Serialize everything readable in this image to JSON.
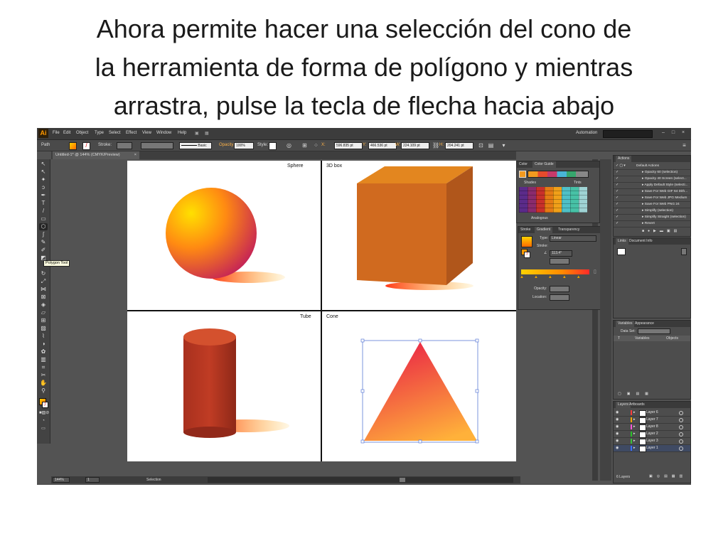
{
  "title_lines": [
    "Ahora permite hacer una selección del cono de",
    "la herramienta de forma de polígono y mientras",
    "arrastra, pulse la tecla de flecha hacia abajo"
  ],
  "app": {
    "logo": "Ai",
    "menu": [
      "File",
      "Edit",
      "Object",
      "Type",
      "Select",
      "Effect",
      "View",
      "Window",
      "Help"
    ],
    "workspace": "Automation",
    "control_bar": {
      "selection_label": "Path",
      "stroke_label": "Stroke:",
      "brush_label": "Basic",
      "opacity_label": "Opacity:",
      "opacity_value": "100%",
      "style_label": "Style:",
      "x_value": "596.835 pt",
      "y_value": "466.536 pt",
      "w_value": "224.109 pt",
      "h_value": "204.241 pt"
    },
    "document_tab": "Untitled-1* @ 144% (CMYK/Preview)",
    "tooltip": "Polygon Tool",
    "canvas_labels": {
      "sphere": "Sphere",
      "box": "3D box",
      "tube": "Tube",
      "cone": "Cone"
    },
    "status": {
      "zoom": "144%",
      "page": "1",
      "mode": "Selection"
    },
    "color_panel": {
      "tabs": [
        "Color",
        "Color Guide"
      ],
      "shades_label": "Shades",
      "tints_label": "Tints",
      "harmony": "Analogous"
    },
    "gradient_panel": {
      "tabs": [
        "Stroke",
        "Gradient",
        "Transparency"
      ],
      "type_label": "Type:",
      "type_value": "Linear",
      "stroke_label": "Stroke:",
      "angle_value": "113.4°",
      "opacity_label": "Opacity:",
      "location_label": "Location:"
    },
    "actions_panel": {
      "tab": "Actions",
      "set_name": "Default Actions",
      "items": [
        "Opacity 60 (selection)",
        "Opacity 40 Screen (select...",
        "Apply Default Style (selecti...",
        "Save For Web GIF 64 Dith...",
        "Save For Web JPG Medium",
        "Save For Web PNG 24",
        "Simplify (selection)",
        "Simplify Straight (selection)",
        "Revert"
      ]
    },
    "links_panel": {
      "tabs": [
        "Links",
        "Document Info"
      ]
    },
    "variables_panel": {
      "tabs": [
        "Variables",
        "Appearance"
      ],
      "dataset_label": "Data Set:",
      "columns": [
        "Variables",
        "Objects"
      ]
    },
    "layers_panel": {
      "tabs": [
        "Layers",
        "Artboards"
      ],
      "layers": [
        {
          "name": "Layer 6",
          "color": "#ff3b3b"
        },
        {
          "name": "Layer 7",
          "color": "#f2a900"
        },
        {
          "name": "Layer 8",
          "color": "#ff57d8"
        },
        {
          "name": "Layer 2",
          "color": "#28c028"
        },
        {
          "name": "Layer 3",
          "color": "#39c239"
        },
        {
          "name": "Layer 1",
          "color": "#3a6dff"
        }
      ],
      "count": "6 Layers"
    }
  }
}
